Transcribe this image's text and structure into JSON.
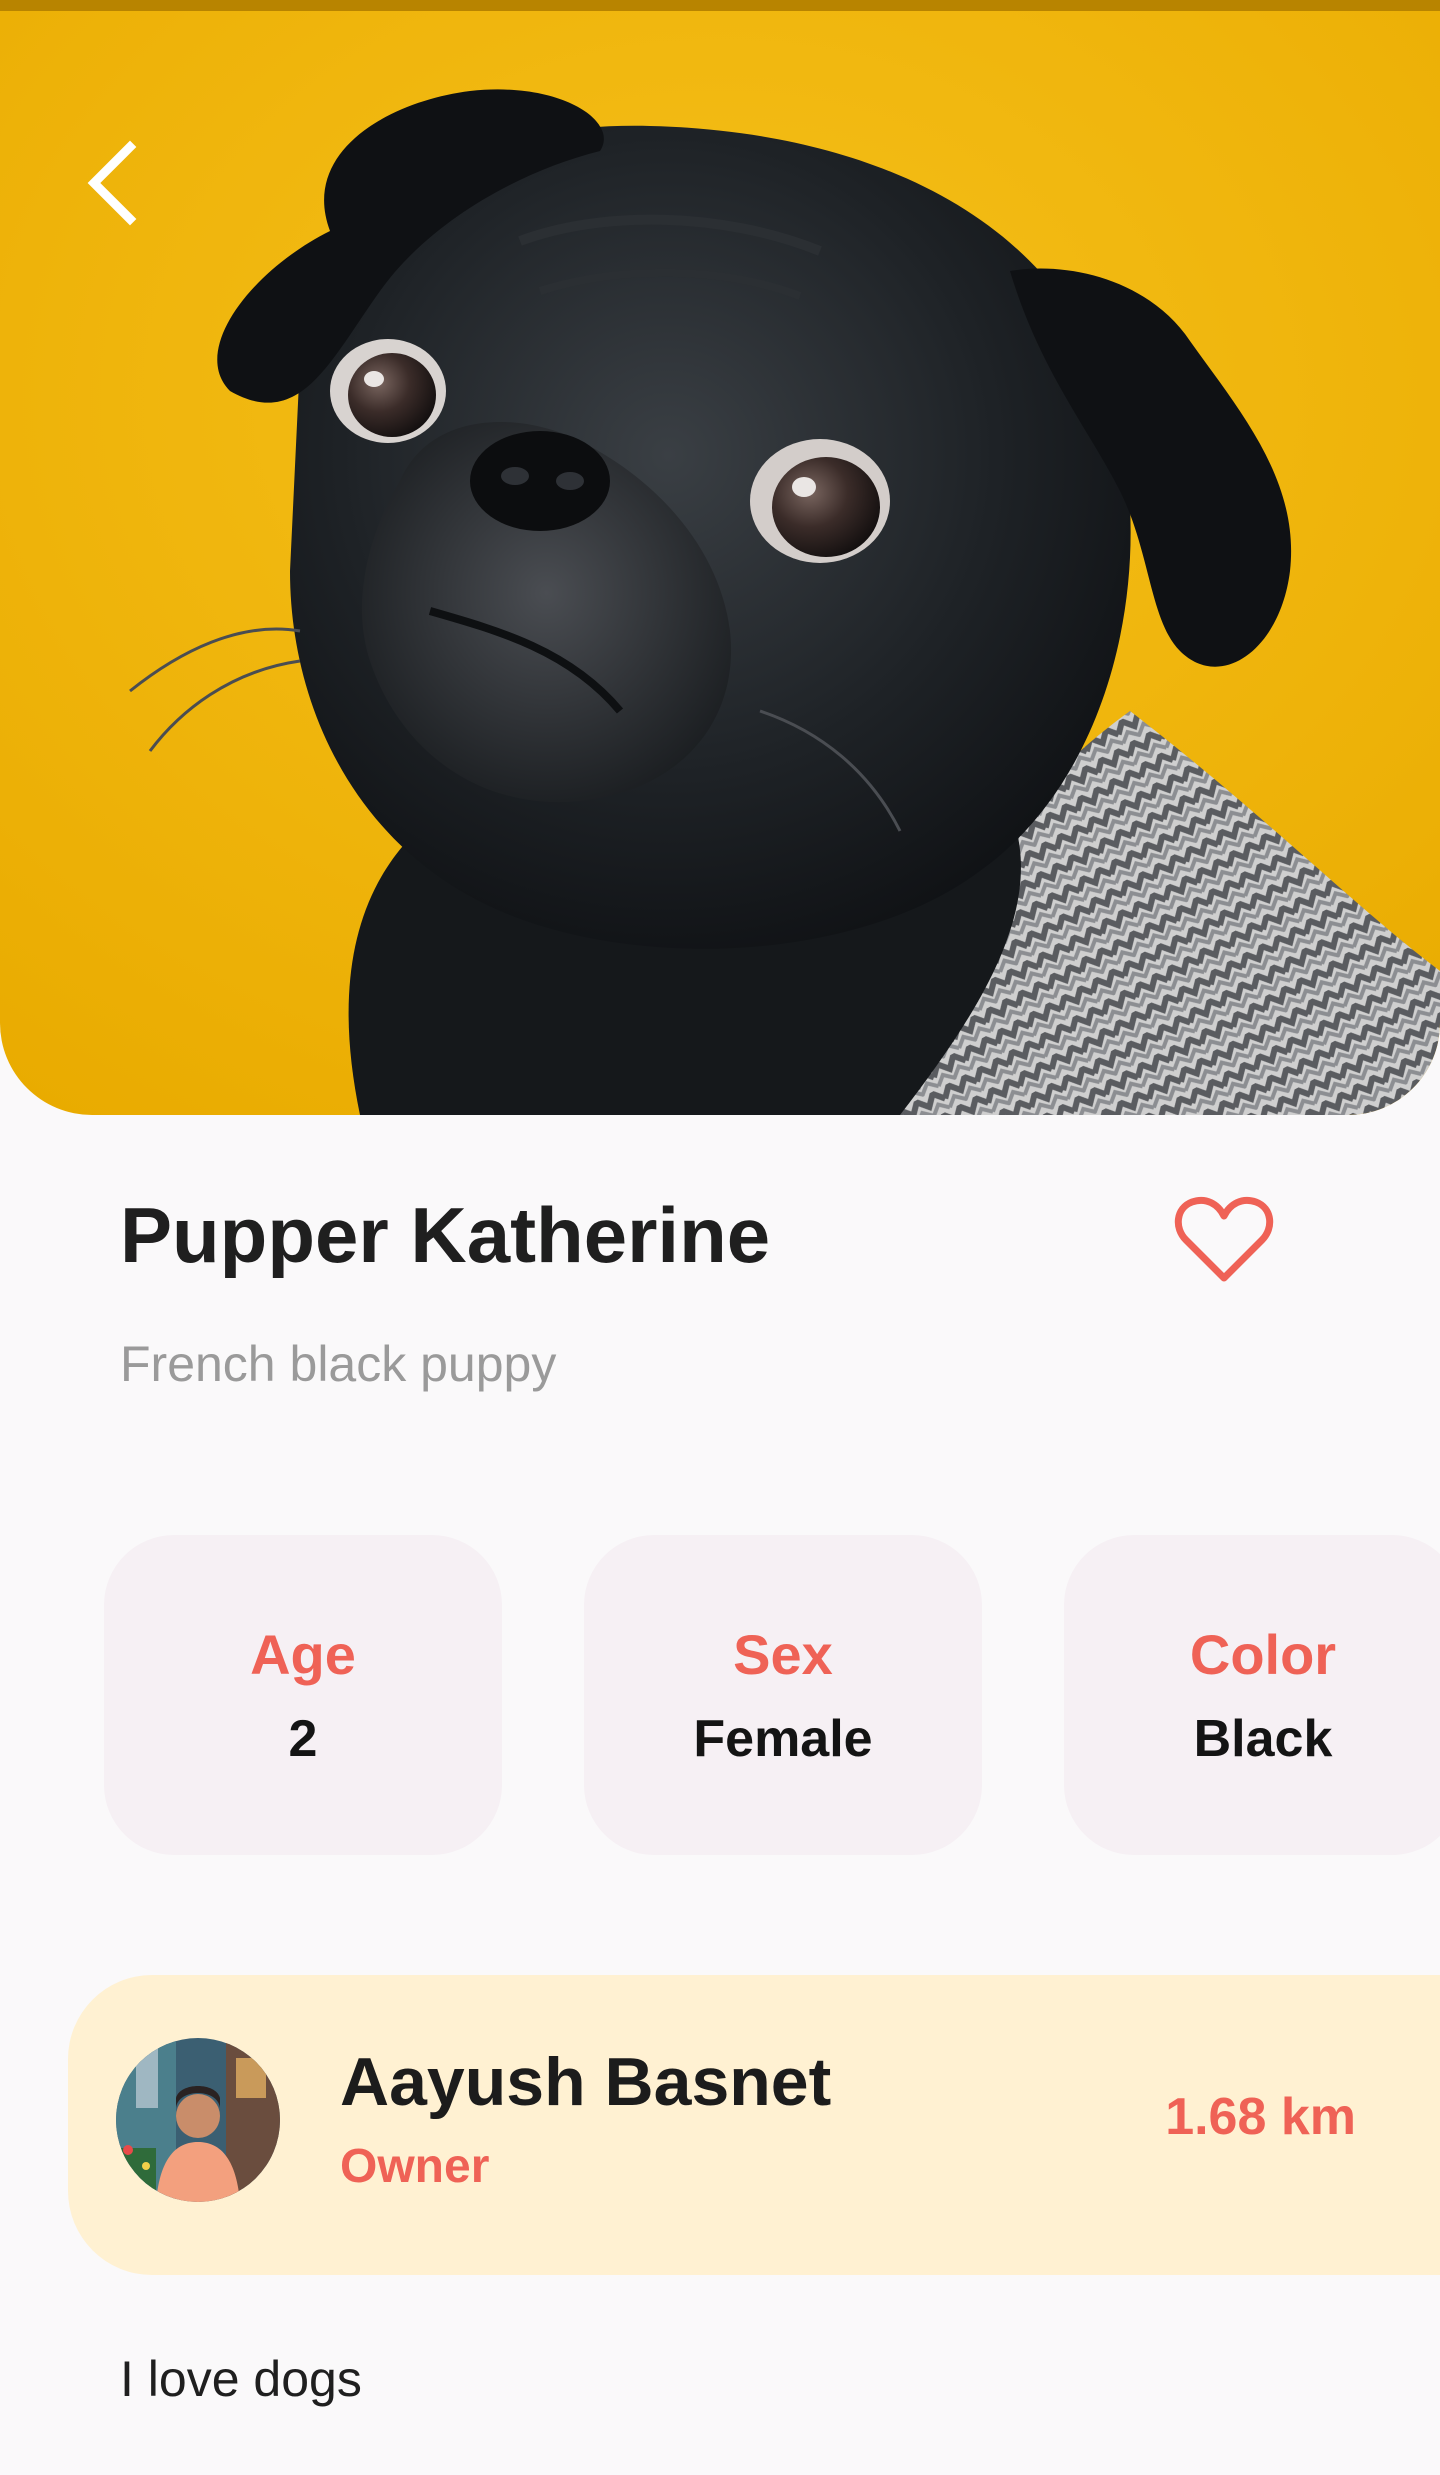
{
  "colors": {
    "accent": "#ef6256",
    "hero_background": "#f0b508",
    "status_strip": "#b88400",
    "stat_card_background": "#f6f0f4",
    "owner_card_background": "#fff1d2",
    "page_background": "#faf9fa"
  },
  "header": {
    "back_icon": "chevron-left-icon",
    "hero_image": "black-pug-photo"
  },
  "pet": {
    "name": "Pupper Katherine",
    "subtitle": "French black puppy",
    "favorite_icon": "heart-outline-icon"
  },
  "stats": [
    {
      "label": "Age",
      "value": "2"
    },
    {
      "label": "Sex",
      "value": "Female"
    },
    {
      "label": "Color",
      "value": "Black"
    }
  ],
  "owner": {
    "avatar": "owner-avatar-photo",
    "name": "Aayush Basnet",
    "role": "Owner",
    "distance": "1.68 km"
  },
  "description": "I love dogs"
}
